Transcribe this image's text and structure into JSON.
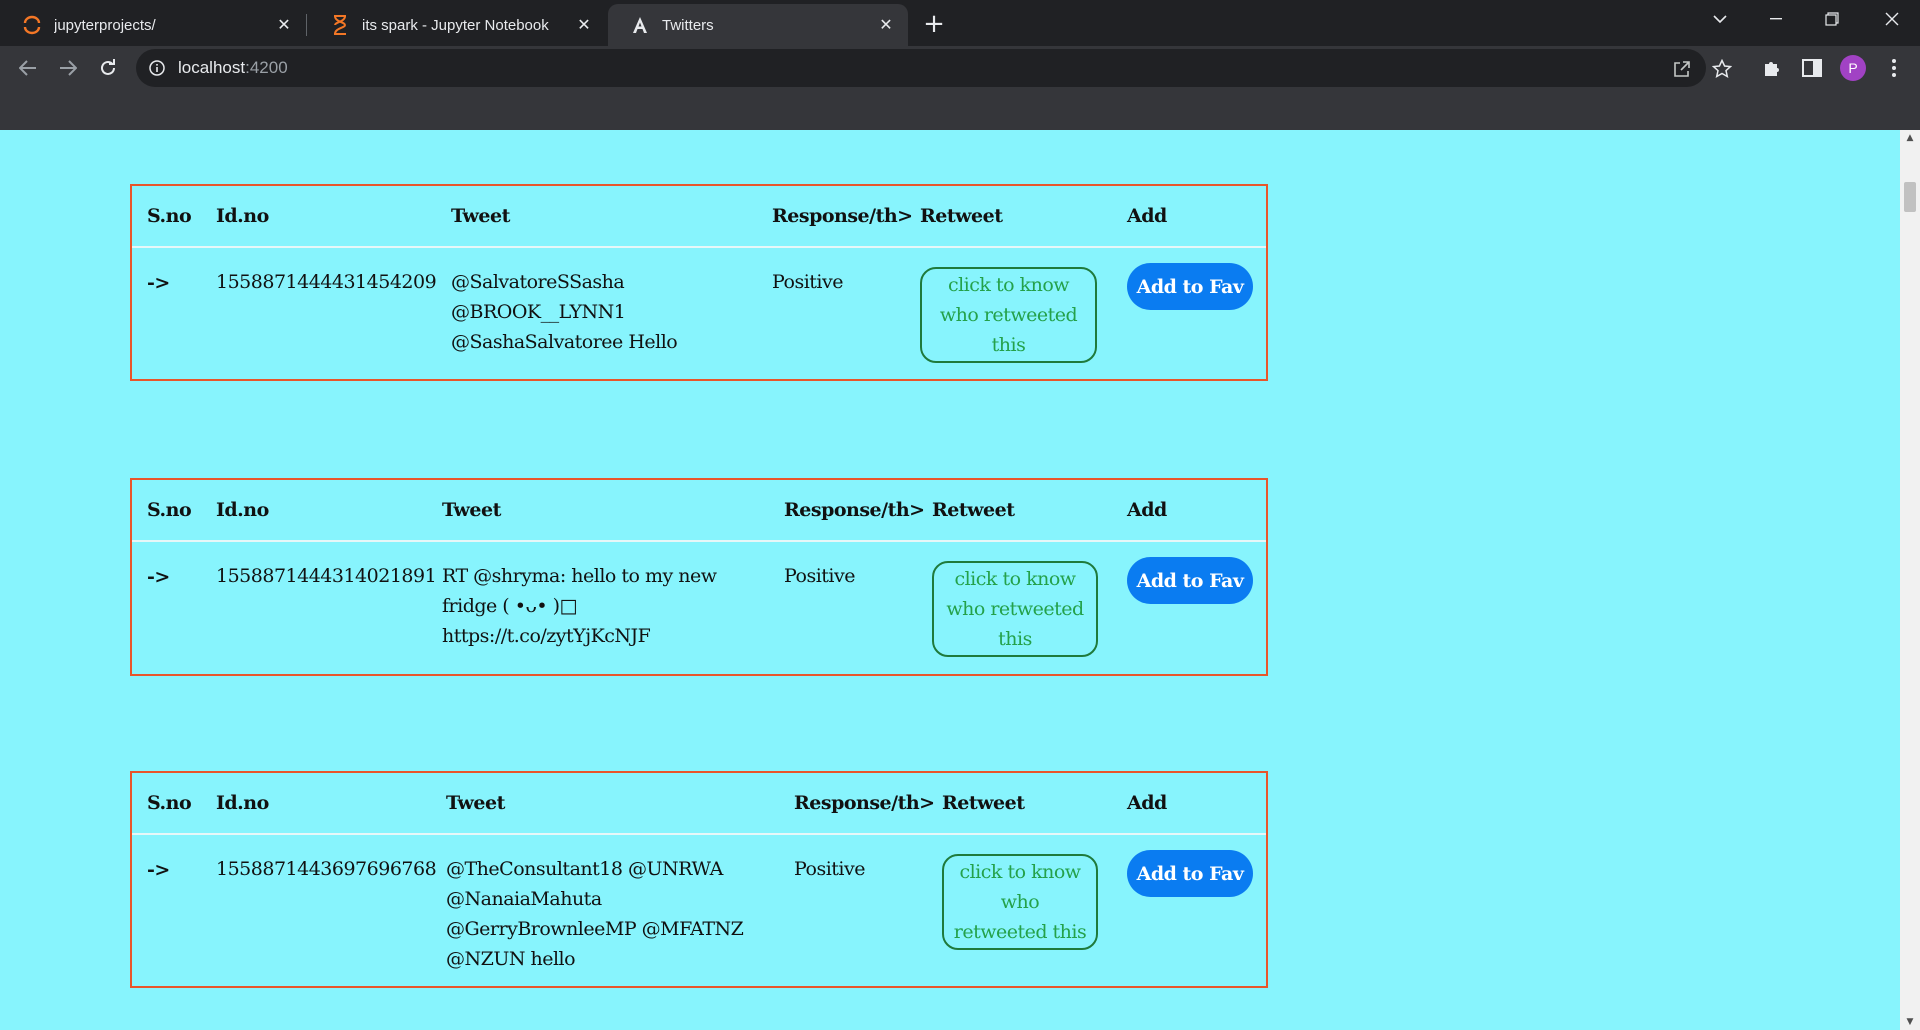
{
  "browser": {
    "tabs": [
      {
        "title": "jupyterprojects/",
        "icon": "jupyter-icon",
        "active": false
      },
      {
        "title": "its spark - Jupyter Notebook",
        "icon": "hourglass-icon",
        "active": false
      },
      {
        "title": "Twitters",
        "icon": "angular-icon",
        "active": true
      }
    ],
    "address": {
      "host": "localhost",
      "port": ":4200"
    },
    "profile_initial": "P",
    "colors": {
      "tab_strip": "#202124",
      "toolbar": "#35363a",
      "avatar": "#a142c4"
    }
  },
  "page": {
    "background": "#87f4fd",
    "border_color": "#e8552a",
    "fav_button_color": "#0a7cf1",
    "retweet_text_color": "#24a14a",
    "headers": {
      "sno": "S.no",
      "id": "Id.no",
      "tweet": "Tweet",
      "response": "Response/th>",
      "retweet": "Retweet",
      "add": "Add"
    },
    "rows": [
      {
        "sno": "->",
        "id": "1558871444431454209",
        "tweet": "@SalvatoreSSasha @BROOK__LYNN1 @SashaSalvatoree Hello",
        "response": "Positive",
        "retweet_label": "click to know who retweeted this",
        "fav_label": "Add to Fav"
      },
      {
        "sno": "->",
        "id": "1558871444314021891",
        "tweet": "RT @shryma: hello to my new fridge ( •ᴗ• )□ https://t.co/zytYjKcNJF",
        "response": "Positive",
        "retweet_label": "click to know who retweeted this",
        "fav_label": "Add to Fav"
      },
      {
        "sno": "->",
        "id": "1558871443697696768",
        "tweet": "@TheConsultant18 @UNRWA @NanaiaMahuta @GerryBrownleeMP @MFATNZ @NZUN hello",
        "response": "Positive",
        "retweet_label": "click to know who retweeted this",
        "fav_label": "Add to Fav"
      }
    ]
  }
}
